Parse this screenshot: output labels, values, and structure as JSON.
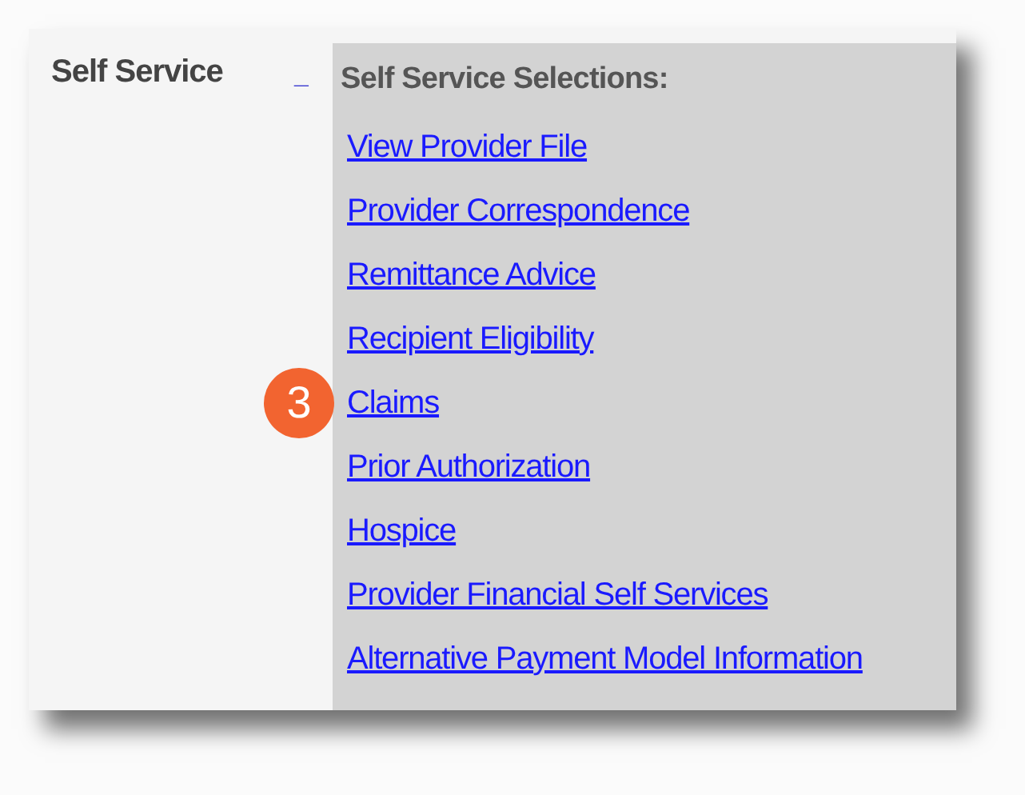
{
  "menu": {
    "title": "Self Service",
    "toggle": "_"
  },
  "submenu": {
    "heading": "Self Service Selections:",
    "links": [
      {
        "label": "View Provider File"
      },
      {
        "label": "Provider Correspondence"
      },
      {
        "label": "Remittance Advice"
      },
      {
        "label": "Recipient Eligibility"
      },
      {
        "label": "Claims",
        "callout": "3"
      },
      {
        "label": "Prior Authorization"
      },
      {
        "label": "Hospice"
      },
      {
        "label": "Provider Financial Self Services"
      },
      {
        "label": "Alternative Payment Model Information"
      }
    ]
  }
}
